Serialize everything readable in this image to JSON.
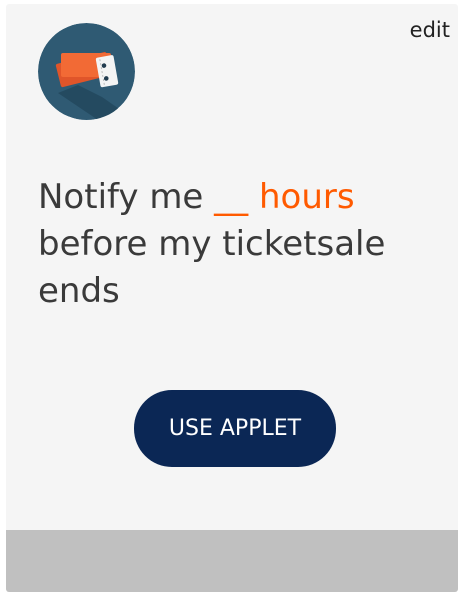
{
  "applet": {
    "edit_label": "edit",
    "icon": "ticket-icon",
    "sentence": {
      "prefix": "Notify me",
      "blank": "__",
      "unit": "hours",
      "suffix": "before my ticketsale ends"
    },
    "button_label": "USE APPLET"
  },
  "colors": {
    "card_background": "#f5f5f5",
    "accent": "#ff5a00",
    "button_background": "#0b2755",
    "icon_circle": "#2f5a73",
    "footer": "#c0c0c0"
  }
}
